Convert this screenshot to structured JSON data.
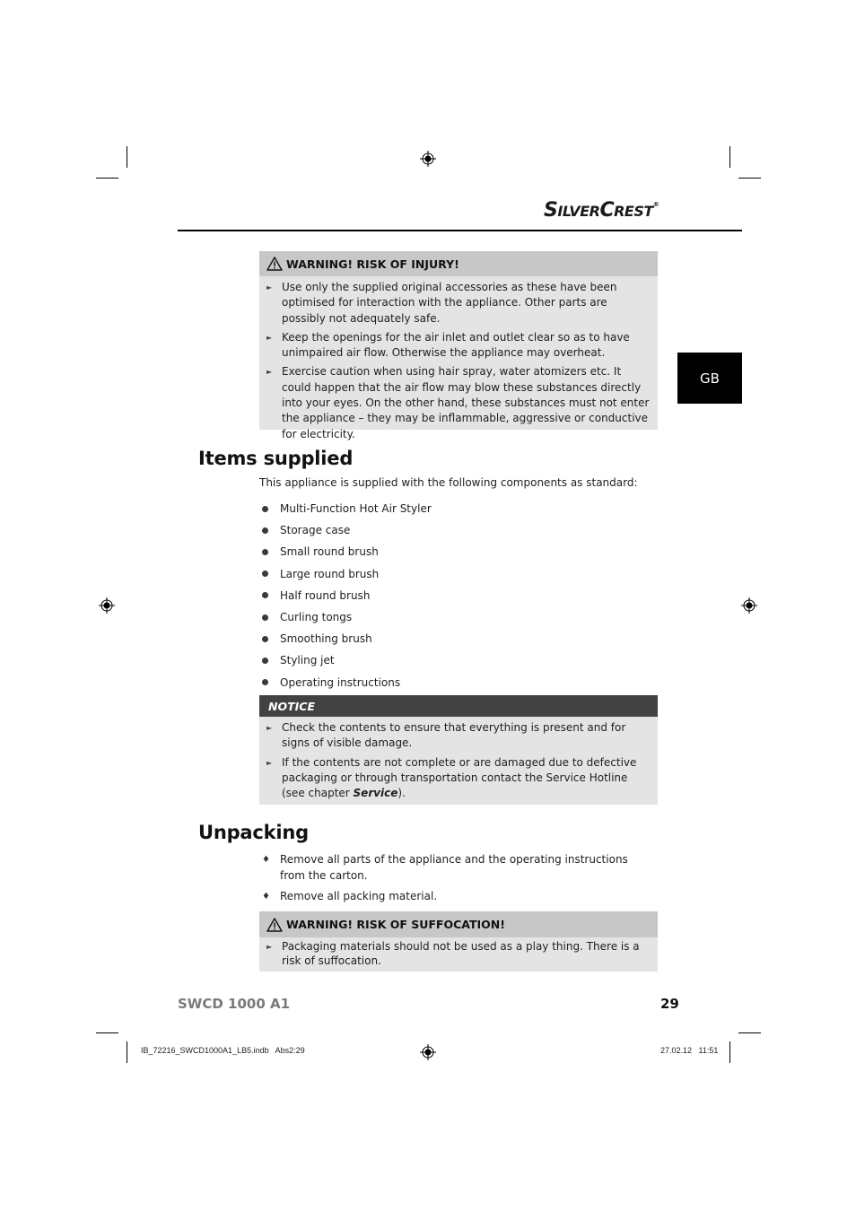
{
  "header": {
    "brand_part1_initial": "S",
    "brand_part1_rest": "ILVER",
    "brand_part2_initial": "C",
    "brand_part2_rest": "REST",
    "brand_registered": "®",
    "language_tab": "GB"
  },
  "warning_injury": {
    "title": "WARNING! RISK OF INJURY!",
    "icon": "warning-triangle-icon",
    "items": [
      "Use only the supplied original accessories as these have been optimised for interaction with the appliance. Other parts are possibly not adequately safe.",
      "Keep the openings for the air inlet and outlet clear so as to have unimpaired air flow. Otherwise the appliance may overheat.",
      "Exercise caution when using hair spray, water atomizers etc. It could happen that the air flow may blow these substances directly into your eyes. On the other hand, these substances must not enter the appliance – they may be inflammable, aggressive or conductive for electricity."
    ]
  },
  "items_supplied": {
    "heading": "Items supplied",
    "intro": "This appliance is supplied with the following components as standard:",
    "items": [
      "Multi-Function Hot Air Styler",
      "Storage case",
      "Small round brush",
      "Large round brush",
      "Half round brush",
      "Curling tongs",
      "Smoothing brush",
      "Styling jet",
      "Operating instructions"
    ]
  },
  "notice": {
    "title": "NOTICE",
    "items": [
      {
        "text": "Check the contents to ensure that everything is present and for signs of visible damage."
      },
      {
        "text": "If the contents are not complete or are damaged due to defective packaging or through transportation contact the Service Hotline (see chapter ",
        "emph": "Service",
        "after": ")."
      }
    ]
  },
  "unpacking": {
    "heading": "Unpacking",
    "items": [
      "Remove all parts of the appliance and the operating instructions from the carton.",
      "Remove all packing material."
    ]
  },
  "warning_suffocation": {
    "title": "WARNING! RISK OF SUFFOCATION!",
    "icon": "warning-triangle-icon",
    "items": [
      "Packaging materials should not be used as a play thing. There is a risk of suffocation."
    ]
  },
  "footer": {
    "model": "SWCD 1000 A1",
    "page_number": "29",
    "slug_left": "IB_72216_SWCD1000A1_LB5.indb   Abs2:29",
    "slug_right": "27.02.12   11:51"
  }
}
